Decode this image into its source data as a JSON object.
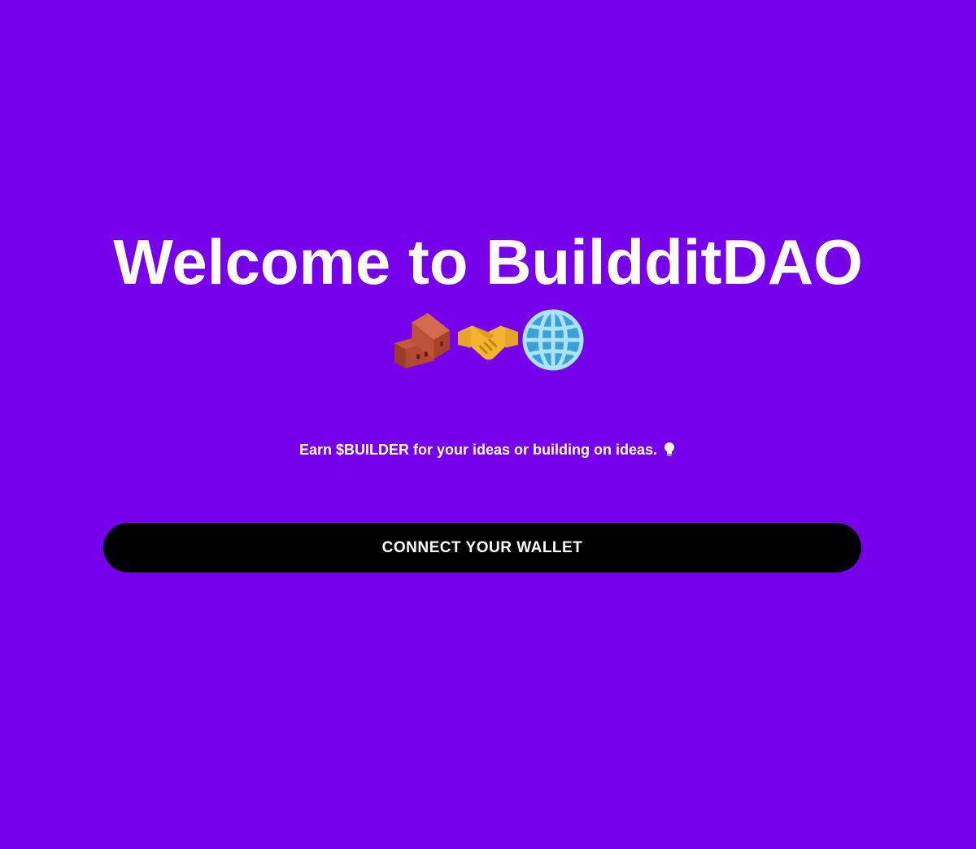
{
  "hero": {
    "title": "Welcome to BuildditDAO",
    "emojis": [
      "brick-icon",
      "handshake-icon",
      "globe-icon"
    ],
    "subtitle": "Earn $BUILDER for your ideas or building on ideas.",
    "subtitle_icon": "lightbulb-icon"
  },
  "actions": {
    "connect_label": "CONNECT YOUR WALLET"
  },
  "colors": {
    "background": "#7700ea",
    "text": "#ffffff",
    "button_bg": "#000000",
    "button_text": "#ffffff"
  }
}
